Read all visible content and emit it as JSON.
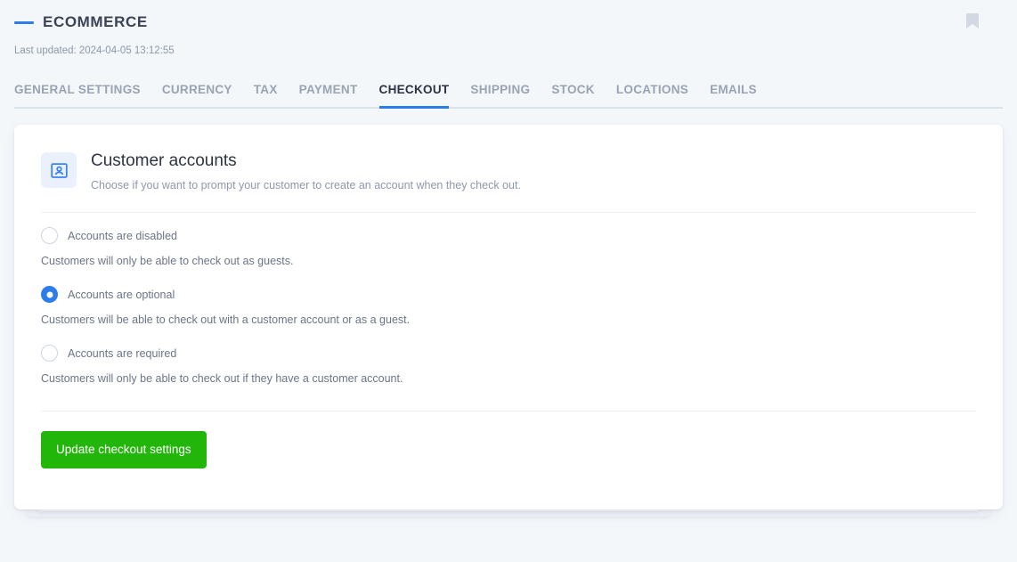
{
  "header": {
    "title": "ECOMMERCE",
    "last_updated": "Last updated: 2024-04-05 13:12:55",
    "bookmark_icon": "bookmark-icon",
    "accent_color": "#2b7de9"
  },
  "tabs": [
    {
      "label": "GENERAL SETTINGS",
      "active": false
    },
    {
      "label": "CURRENCY",
      "active": false
    },
    {
      "label": "TAX",
      "active": false
    },
    {
      "label": "PAYMENT",
      "active": false
    },
    {
      "label": "CHECKOUT",
      "active": true
    },
    {
      "label": "SHIPPING",
      "active": false
    },
    {
      "label": "STOCK",
      "active": false
    },
    {
      "label": "LOCATIONS",
      "active": false
    },
    {
      "label": "EMAILS",
      "active": false
    }
  ],
  "card": {
    "icon": "contact-card-icon",
    "title": "Customer accounts",
    "subtitle": "Choose if you want to prompt your customer to create an account when they check out.",
    "options": [
      {
        "label": "Accounts are disabled",
        "description": "Customers will only be able to check out as guests.",
        "selected": false
      },
      {
        "label": "Accounts are optional",
        "description": "Customers will be able to check out with a customer account or as a guest.",
        "selected": true
      },
      {
        "label": "Accounts are required",
        "description": "Customers will only be able to check out if they have a customer account.",
        "selected": false
      }
    ],
    "submit_label": "Update checkout settings",
    "submit_color": "#22b60b"
  }
}
